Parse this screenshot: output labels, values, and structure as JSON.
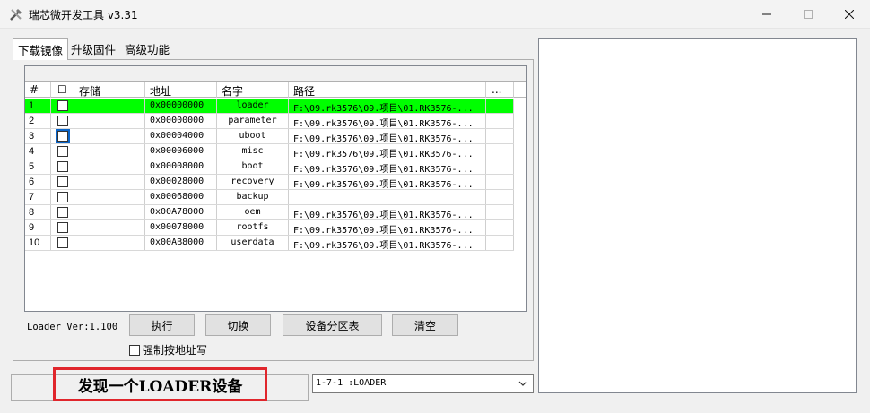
{
  "window": {
    "title": "瑞芯微开发工具 v3.31",
    "min_icon": "minimize-icon",
    "max_icon": "maximize-icon",
    "close_icon": "close-icon"
  },
  "tabs": [
    {
      "label": "下载镜像",
      "active": true
    },
    {
      "label": "升级固件",
      "active": false
    },
    {
      "label": "高级功能",
      "active": false
    }
  ],
  "table": {
    "columns": {
      "num": "#",
      "check": "☐",
      "store": "存储",
      "addr": "地址",
      "name": "名字",
      "path": "路径",
      "more": "..."
    },
    "rows": [
      {
        "num": "1",
        "addr": "0x00000000",
        "name": "loader",
        "path": "F:\\09.rk3576\\09.项目\\01.RK3576-...",
        "checked": false,
        "selected": true
      },
      {
        "num": "2",
        "addr": "0x00000000",
        "name": "parameter",
        "path": "F:\\09.rk3576\\09.项目\\01.RK3576-...",
        "checked": false
      },
      {
        "num": "3",
        "addr": "0x00004000",
        "name": "uboot",
        "path": "F:\\09.rk3576\\09.项目\\01.RK3576-...",
        "checked": false,
        "focused": true
      },
      {
        "num": "4",
        "addr": "0x00006000",
        "name": "misc",
        "path": "F:\\09.rk3576\\09.项目\\01.RK3576-...",
        "checked": false
      },
      {
        "num": "5",
        "addr": "0x00008000",
        "name": "boot",
        "path": "F:\\09.rk3576\\09.项目\\01.RK3576-...",
        "checked": false
      },
      {
        "num": "6",
        "addr": "0x00028000",
        "name": "recovery",
        "path": "F:\\09.rk3576\\09.项目\\01.RK3576-...",
        "checked": false
      },
      {
        "num": "7",
        "addr": "0x00068000",
        "name": "backup",
        "path": "",
        "checked": false
      },
      {
        "num": "8",
        "addr": "0x00A78000",
        "name": "oem",
        "path": "F:\\09.rk3576\\09.项目\\01.RK3576-...",
        "checked": false
      },
      {
        "num": "9",
        "addr": "0x00078000",
        "name": "rootfs",
        "path": "F:\\09.rk3576\\09.项目\\01.RK3576-...",
        "checked": false
      },
      {
        "num": "10",
        "addr": "0x00AB8000",
        "name": "userdata",
        "path": "F:\\09.rk3576\\09.项目\\01.RK3576-...",
        "checked": false
      }
    ]
  },
  "loader_ver": "Loader Ver:1.100",
  "buttons": {
    "run": "执行",
    "switch": "切换",
    "partition": "设备分区表",
    "clear": "清空"
  },
  "force_addr_label": "强制按地址写",
  "status": "发现一个LOADER设备",
  "device_select": "1-7-1 :LOADER",
  "colors": {
    "selected_row": "#00ff00",
    "status_border": "#e0262c"
  }
}
